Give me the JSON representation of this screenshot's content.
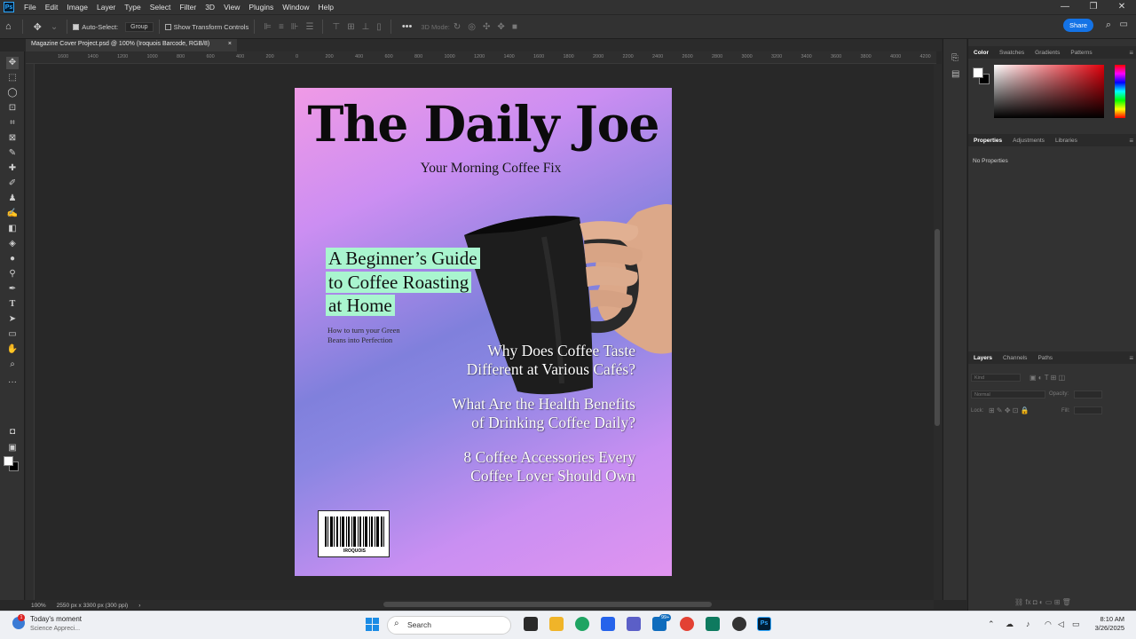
{
  "app": {
    "menu": [
      "File",
      "Edit",
      "Image",
      "Layer",
      "Type",
      "Select",
      "Filter",
      "3D",
      "View",
      "Plugins",
      "Window",
      "Help"
    ],
    "window_controls": [
      "—",
      "❐",
      "✕"
    ]
  },
  "options_bar": {
    "auto_select_label": "Auto-Select:",
    "group_value": "Group",
    "transform_label": "Show Transform Controls",
    "mode_3d_label": "3D Mode:",
    "share_label": "Share"
  },
  "document": {
    "tab_title": "Magazine Cover Project.psd @ 100% (Iroquois Barcode, RGB/8)",
    "zoom": "100%",
    "size_info": "2550 px x 3300 px (300 ppi)"
  },
  "ruler_labels": [
    "1600",
    "1400",
    "1200",
    "1000",
    "800",
    "600",
    "400",
    "200",
    "0",
    "200",
    "400",
    "600",
    "800",
    "1000",
    "1200",
    "1400",
    "1600",
    "1800",
    "2000",
    "2200",
    "2400",
    "2600",
    "2800",
    "3000",
    "3200",
    "3400",
    "3600",
    "3800",
    "4000",
    "4200"
  ],
  "cover": {
    "title": "The Daily Joe",
    "subtitle": "Your Morning Coffee Fix",
    "main_story_lines": [
      "A Beginner’s Guide",
      "to Coffee Roasting",
      "at Home"
    ],
    "main_story_sub": "How to turn your Green Beans into Perfection",
    "stories": [
      {
        "line1": "Why Does Coffee Taste",
        "line2": "Different at Various Cafés?"
      },
      {
        "line1": "What Are the Health Benefits",
        "line2": "of Drinking Coffee Daily?"
      },
      {
        "line1": "8 Coffee Accessories Every",
        "line2": "Coffee Lover Should Own"
      }
    ],
    "barcode_label": "IROQUOIS",
    "colors": {
      "gradient_pink": "#f09ae6",
      "gradient_blue": "#8080dc",
      "highlight": "#a9f5cf"
    }
  },
  "panels": {
    "color_tabs": [
      "Color",
      "Swatches",
      "Gradients",
      "Patterns"
    ],
    "properties_tabs": [
      "Properties",
      "Adjustments",
      "Libraries"
    ],
    "no_properties": "No Properties",
    "layers_tabs": [
      "Layers",
      "Channels",
      "Paths"
    ],
    "layers_kind": "Kind",
    "layers_blend": "Normal",
    "layers_opacity": "Opacity:",
    "layers_lock": "Lock:",
    "layers_fill": "Fill:"
  },
  "taskbar": {
    "weather_title": "Today's moment",
    "weather_sub": "Science Appreci...",
    "search_label": "Search",
    "badge_count": "99+",
    "time": "8:10 AM",
    "date": "3/26/2025"
  }
}
